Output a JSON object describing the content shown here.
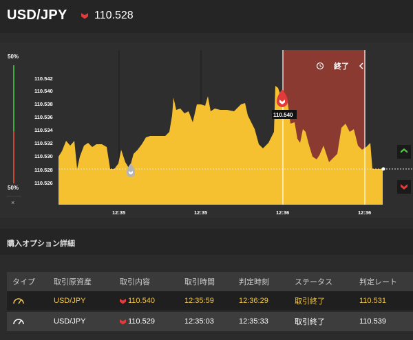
{
  "header": {
    "pair": "USD/JPY",
    "rate": "110.528",
    "trend_icon": "down-arrow-icon",
    "trend_color": "#e23b3b"
  },
  "gauge": {
    "top_pct": "50%",
    "bottom_pct": "50%",
    "close": "×"
  },
  "chart": {
    "y_ticks": [
      "110.542",
      "110.540",
      "110.538",
      "110.536",
      "110.534",
      "110.532",
      "110.530",
      "110.528",
      "110.526"
    ],
    "x_ticks": [
      "12:35",
      "12:35",
      "12:36",
      "12:36"
    ],
    "current_rate": "110.528",
    "entry_label": "110.540",
    "expiry_label": "終了",
    "area_color": "#f5c131",
    "expiry_region_color": "#8a3a30"
  },
  "section": {
    "title": "購入オプション詳細"
  },
  "table": {
    "headers": [
      "タイプ",
      "取引原資産",
      "取引内容",
      "取引時間",
      "判定時刻",
      "ステータス",
      "判定レート"
    ],
    "rows": [
      {
        "type_icon": "gauge-icon",
        "asset": "USD/JPY",
        "content": "110.540",
        "trade_time": "12:35:59",
        "judge_time": "12:36:29",
        "status": "取引終了",
        "judge_rate": "110.531",
        "highlight": true
      },
      {
        "type_icon": "gauge-icon",
        "asset": "USD/JPY",
        "content": "110.529",
        "trade_time": "12:35:03",
        "judge_time": "12:35:33",
        "status": "取引終了",
        "judge_rate": "110.539",
        "highlight": false
      }
    ]
  }
}
